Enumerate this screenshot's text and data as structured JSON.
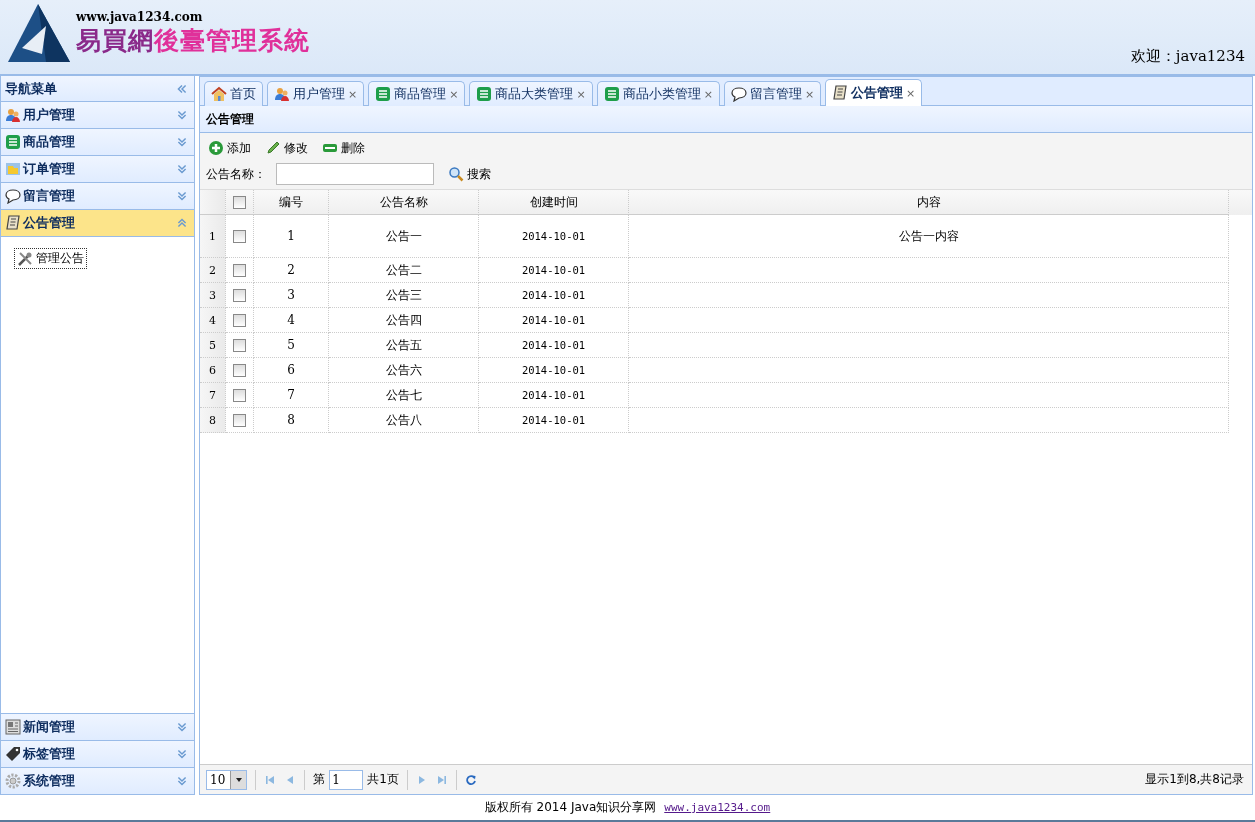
{
  "header": {
    "site_url": "www.java1234.com",
    "title_first": "易買網",
    "title_rest": "後臺管理系統",
    "welcome": "欢迎：java1234"
  },
  "sidebar": {
    "title": "导航菜单",
    "items": [
      {
        "label": "用户管理",
        "kind": "users",
        "expanded": false
      },
      {
        "label": "商品管理",
        "kind": "list",
        "expanded": false
      },
      {
        "label": "订单管理",
        "kind": "folder",
        "expanded": false
      },
      {
        "label": "留言管理",
        "kind": "chat",
        "expanded": false
      },
      {
        "label": "公告管理",
        "kind": "scroll",
        "expanded": true,
        "children": [
          {
            "label": "管理公告",
            "kind": "tools",
            "selected": true
          }
        ]
      },
      {
        "label": "新闻管理",
        "kind": "news",
        "expanded": false
      },
      {
        "label": "标签管理",
        "kind": "tag",
        "expanded": false
      },
      {
        "label": "系统管理",
        "kind": "gear",
        "expanded": false
      }
    ]
  },
  "tabs": [
    {
      "label": "首页",
      "kind": "home",
      "selected": false
    },
    {
      "label": "用户管理",
      "kind": "users",
      "close": "×",
      "selected": false
    },
    {
      "label": "商品管理",
      "kind": "list",
      "close": "×",
      "selected": false
    },
    {
      "label": "商品大类管理",
      "kind": "list",
      "close": "×",
      "selected": false
    },
    {
      "label": "商品小类管理",
      "kind": "list",
      "close": "×",
      "selected": false
    },
    {
      "label": "留言管理",
      "kind": "chat",
      "close": "×",
      "selected": false
    },
    {
      "label": "公告管理",
      "kind": "scroll",
      "close": "×",
      "selected": true
    }
  ],
  "panel": {
    "title": "公告管理",
    "toolbar": [
      {
        "label": "添加",
        "kind": "add"
      },
      {
        "label": "修改",
        "kind": "edit"
      },
      {
        "label": "删除",
        "kind": "remove"
      }
    ],
    "search": {
      "label": "公告名称：",
      "button": "搜索"
    },
    "table": {
      "header_checked": false,
      "columns": [
        "编号",
        "公告名称",
        "创建时间",
        "内容"
      ],
      "rows": [
        {
          "row_number": "1",
          "checked": false,
          "cells": [
            "1",
            "公告一",
            "2014-10-01",
            "公告一内容"
          ]
        },
        {
          "row_number": "2",
          "checked": false,
          "cells": [
            "2",
            "公告二",
            "2014-10-01",
            null
          ]
        },
        {
          "row_number": "3",
          "checked": false,
          "cells": [
            "3",
            "公告三",
            "2014-10-01",
            null
          ]
        },
        {
          "row_number": "4",
          "checked": false,
          "cells": [
            "4",
            "公告四",
            "2014-10-01",
            null
          ]
        },
        {
          "row_number": "5",
          "checked": false,
          "cells": [
            "5",
            "公告五",
            "2014-10-01",
            null
          ]
        },
        {
          "row_number": "6",
          "checked": false,
          "cells": [
            "6",
            "公告六",
            "2014-10-01",
            null
          ]
        },
        {
          "row_number": "7",
          "checked": false,
          "cells": [
            "7",
            "公告七",
            "2014-10-01",
            null
          ]
        },
        {
          "row_number": "8",
          "checked": false,
          "cells": [
            "8",
            "公告八",
            "2014-10-01",
            null
          ]
        }
      ]
    },
    "pager": {
      "page_size": "10",
      "page_prefix": "第",
      "page": "1",
      "page_total": "共1页",
      "summary": "显示1到8,共8记录"
    }
  },
  "footer": {
    "text": "版权所有 2014 Java知识分享网",
    "link": "www.java1234.com"
  }
}
